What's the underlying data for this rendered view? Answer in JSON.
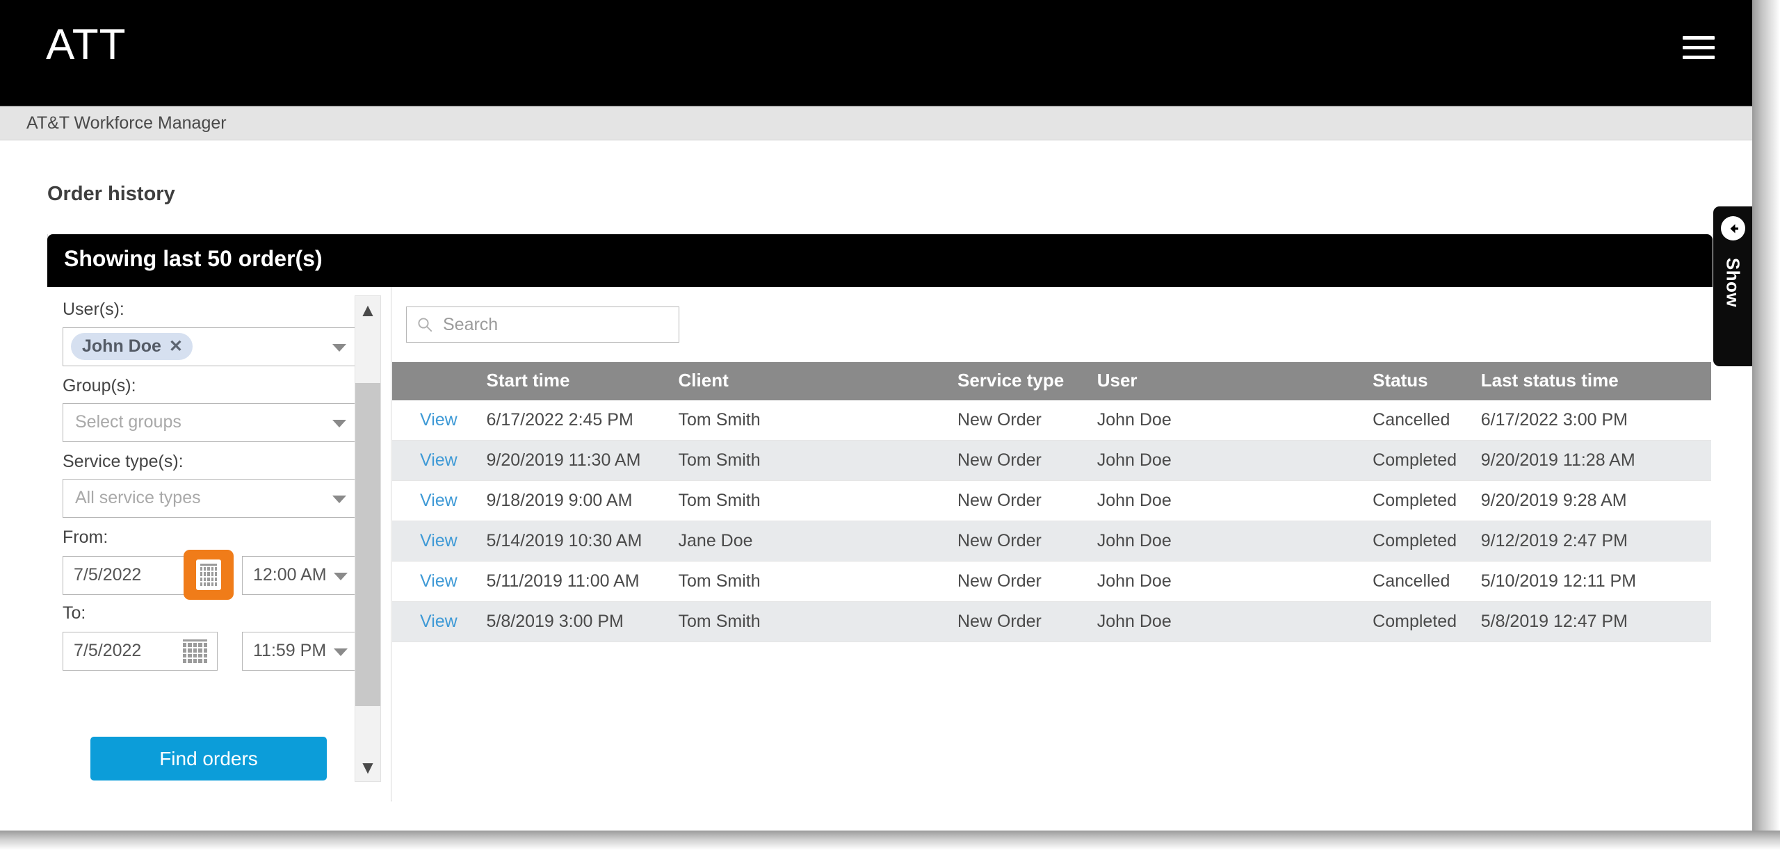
{
  "app": {
    "brand": "ATT",
    "subbar_title": "AT&T Workforce Manager",
    "menu_icon": "hamburger-icon"
  },
  "page": {
    "title": "Order history"
  },
  "card": {
    "header": "Showing last 50 order(s)"
  },
  "filters": {
    "users_label": "User(s):",
    "users_chip": "John Doe",
    "users_chip_remove": "✕",
    "groups_label": "Group(s):",
    "groups_placeholder": "Select groups",
    "service_label": "Service type(s):",
    "service_placeholder": "All service types",
    "from_label": "From:",
    "from_date": "7/5/2022",
    "from_time": "12:00 AM",
    "to_label": "To:",
    "to_date": "7/5/2022",
    "to_time": "11:59 PM",
    "find_button": "Find orders",
    "highlight_color": "#f07c19",
    "button_color": "#0c9dd9"
  },
  "search": {
    "placeholder": "Search",
    "value": ""
  },
  "table": {
    "columns": [
      "",
      "Start time",
      "Client",
      "Service type",
      "User",
      "Status",
      "Last status time"
    ],
    "row_action_label": "View",
    "rows": [
      {
        "action": "View",
        "start_time": "6/17/2022 2:45 PM",
        "client": "Tom Smith",
        "service_type": "New Order",
        "user": "John Doe",
        "status": "Cancelled",
        "last_status_time": "6/17/2022 3:00 PM"
      },
      {
        "action": "View",
        "start_time": "9/20/2019 11:30 AM",
        "client": "Tom Smith",
        "service_type": "New Order",
        "user": "John Doe",
        "status": "Completed",
        "last_status_time": "9/20/2019 11:28 AM"
      },
      {
        "action": "View",
        "start_time": "9/18/2019 9:00 AM",
        "client": "Tom Smith",
        "service_type": "New Order",
        "user": "John Doe",
        "status": "Completed",
        "last_status_time": "9/20/2019 9:28 AM"
      },
      {
        "action": "View",
        "start_time": "5/14/2019 10:30 AM",
        "client": "Jane Doe",
        "service_type": "New Order",
        "user": "John Doe",
        "status": "Completed",
        "last_status_time": "9/12/2019 2:47 PM"
      },
      {
        "action": "View",
        "start_time": "5/11/2019 11:00 AM",
        "client": "Tom Smith",
        "service_type": "New Order",
        "user": "John Doe",
        "status": "Cancelled",
        "last_status_time": "5/10/2019 12:11 PM"
      },
      {
        "action": "View",
        "start_time": "5/8/2019 3:00 PM",
        "client": "Tom Smith",
        "service_type": "New Order",
        "user": "John Doe",
        "status": "Completed",
        "last_status_time": "5/8/2019 12:47 PM"
      }
    ]
  },
  "drawer": {
    "label": "Show",
    "icon": "arrow-left-circle-icon"
  }
}
